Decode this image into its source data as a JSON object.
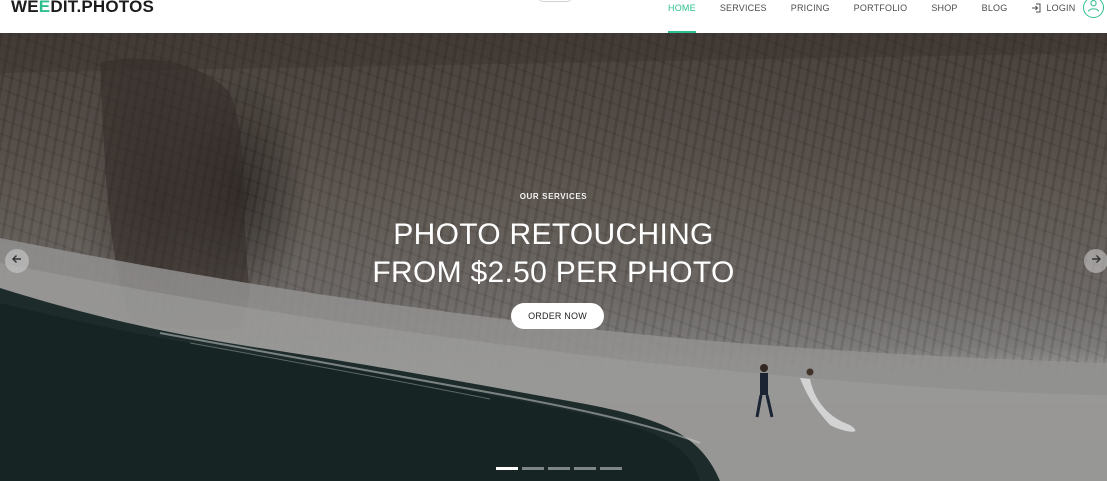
{
  "brand": {
    "logo_part1": "WE",
    "logo_part2": "E",
    "logo_part3": "DIT.PHOTOS",
    "accent_color": "#2dbf8f"
  },
  "nav": {
    "items": [
      {
        "label": "HOME",
        "active": true
      },
      {
        "label": "SERVICES",
        "active": false
      },
      {
        "label": "PRICING",
        "active": false
      },
      {
        "label": "PORTFOLIO",
        "active": false
      },
      {
        "label": "SHOP",
        "active": false
      },
      {
        "label": "BLOG",
        "active": false
      }
    ],
    "login_label": "LOGIN",
    "login_icon": "login-icon",
    "user_icon": "user-icon"
  },
  "hero": {
    "eyebrow": "OUR SERVICES",
    "headline_line1": "PHOTO RETOUCHING",
    "headline_line2": "FROM $2.50 PER PHOTO",
    "cta_label": "ORDER NOW",
    "prev_icon": "arrow-left-icon",
    "next_icon": "arrow-right-icon",
    "slide_count": 5,
    "active_slide": 1
  }
}
